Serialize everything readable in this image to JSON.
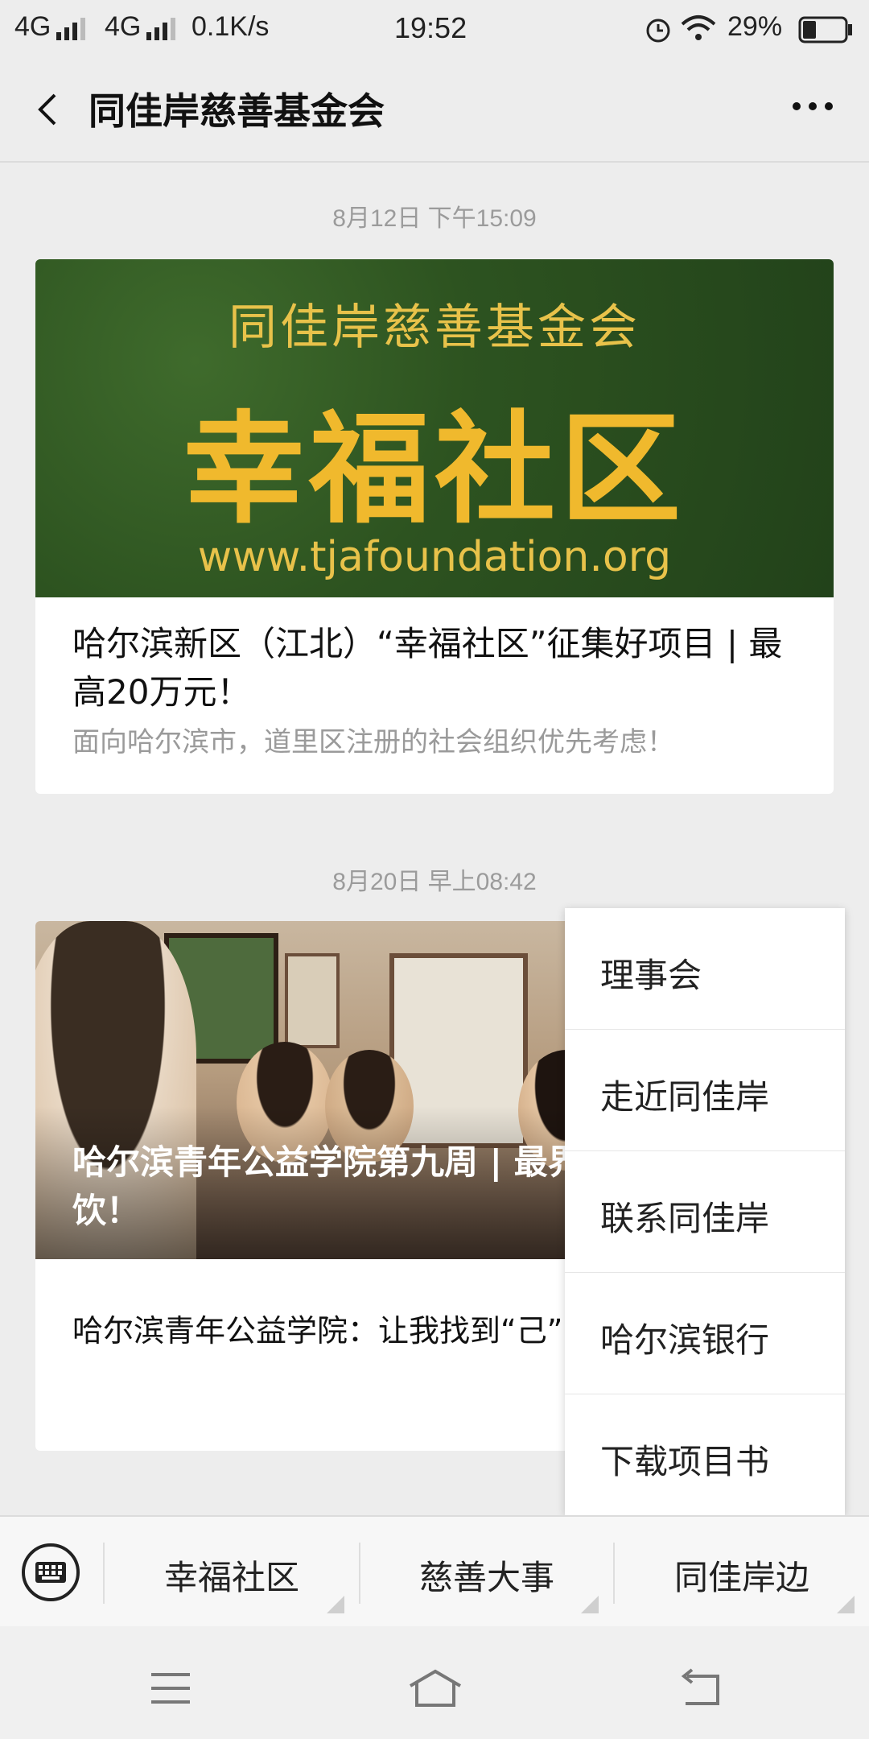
{
  "status_bar": {
    "network1": "4G",
    "network2": "4G",
    "speed": "0.1K/s",
    "time": "19:52",
    "battery": "29%"
  },
  "header": {
    "title": "同佳岸慈善基金会",
    "back_icon": "chevron-left-icon",
    "more_icon": "more-dots-icon"
  },
  "messages": [
    {
      "timestamp": "8月12日 下午15:09",
      "banner": {
        "org": "同佳岸慈善基金会",
        "big_text": "幸福社区",
        "url": "www.tjafoundation.org"
      },
      "headline": "哈尔滨新区（江北）“幸福社区”征集好项目 | 最高20万元！",
      "desc": "面向哈尔滨市，道里区注册的社会组织优先考虑！"
    },
    {
      "timestamp": "8月20日 早上08:42",
      "caption": "哈尔滨青年公益学院第九周 | 最界咖啡 ”里烈饮！",
      "desc": "哈尔滨青年公益学院：让我找到“己”！"
    }
  ],
  "popup_menu": {
    "items": [
      "理事会",
      "走近同佳岸",
      "联系同佳岸",
      "哈尔滨银行",
      "下载项目书"
    ]
  },
  "bottom_menu": {
    "keyboard_icon": "keyboard-icon",
    "tabs": [
      "幸福社区",
      "慈善大事",
      "同佳岸边"
    ]
  },
  "nav_bar": {
    "icons": [
      "menu-icon",
      "home-icon",
      "back-icon"
    ]
  }
}
